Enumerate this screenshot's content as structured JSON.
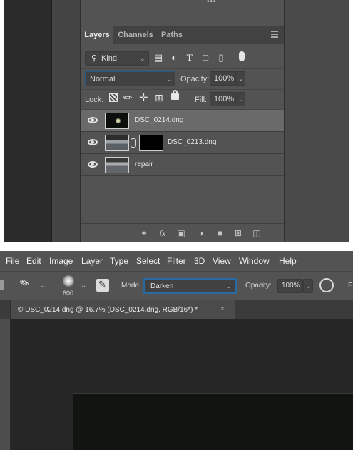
{
  "layers_panel": {
    "tabs": [
      "Layers",
      "Channels",
      "Paths"
    ],
    "filter": {
      "kind_label": "Kind"
    },
    "blend_mode": "Normal",
    "opacity_label": "Opacity:",
    "opacity_value": "100%",
    "lock_label": "Lock:",
    "fill_label": "Fill:",
    "fill_value": "100%",
    "layers": [
      {
        "name": "DSC_0214.dng",
        "selected": true,
        "visible": true
      },
      {
        "name": "DSC_0213.dng",
        "selected": false,
        "visible": true,
        "has_mask": true
      },
      {
        "name": "repair",
        "selected": false,
        "visible": true
      }
    ],
    "bottom_icons": [
      "link-icon",
      "fx-icon",
      "mask-icon",
      "adjustment-icon",
      "folder-icon",
      "new-layer-icon",
      "trash-icon"
    ],
    "bottom_fx_label": "fx"
  },
  "menubar": {
    "items": [
      "File",
      "Edit",
      "Image",
      "Layer",
      "Type",
      "Select",
      "Filter",
      "3D",
      "View",
      "Window",
      "Help"
    ]
  },
  "options_bar": {
    "brush_size": "600",
    "mode_label": "Mode:",
    "mode_value": "Darken",
    "opacity_label": "Opacity:",
    "opacity_value": "100%"
  },
  "document_tab": {
    "title": "© DSC_0214.dng @ 16.7% (DSC_0214.dng, RGB/16*) *",
    "close": "×"
  },
  "colors": {
    "panel_bg": "#535353",
    "selected_row": "#6a6a6a",
    "focus_border": "#2a6aa3",
    "canvas_bg": "#262626"
  }
}
